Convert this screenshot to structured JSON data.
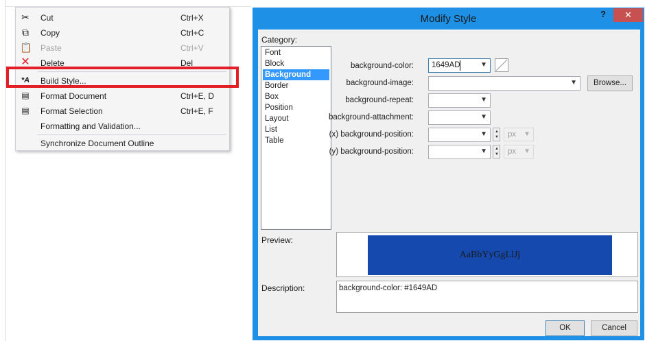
{
  "context_menu": {
    "items": [
      {
        "label": "Cut",
        "shortcut": "Ctrl+X",
        "icon": "scissors-icon",
        "disabled": false
      },
      {
        "label": "Copy",
        "shortcut": "Ctrl+C",
        "icon": "copy-icon",
        "disabled": false
      },
      {
        "label": "Paste",
        "shortcut": "Ctrl+V",
        "icon": "paste-icon",
        "disabled": true
      },
      {
        "label": "Delete",
        "shortcut": "Del",
        "icon": "delete-x-icon",
        "disabled": false
      },
      {
        "label": "Build Style...",
        "shortcut": "",
        "icon": "build-style-icon",
        "disabled": false,
        "highlighted": true
      },
      {
        "label": "Format Document",
        "shortcut": "Ctrl+E, D",
        "icon": "format-document-icon",
        "disabled": false
      },
      {
        "label": "Format Selection",
        "shortcut": "Ctrl+E, F",
        "icon": "format-selection-icon",
        "disabled": false
      },
      {
        "label": "Formatting and Validation...",
        "shortcut": "",
        "icon": "",
        "disabled": false
      },
      {
        "label": "Synchronize Document Outline",
        "shortcut": "",
        "icon": "",
        "disabled": false
      }
    ],
    "highlight_color": "#e41e26"
  },
  "dialog": {
    "title": "Modify Style",
    "help_label": "?",
    "close_label": "✕",
    "category_label": "Category:",
    "categories": [
      "Font",
      "Block",
      "Background",
      "Border",
      "Box",
      "Position",
      "Layout",
      "List",
      "Table"
    ],
    "selected_category": "Background",
    "properties": {
      "background_color": {
        "label": "background-color:",
        "value": "1649AD"
      },
      "background_image": {
        "label": "background-image:",
        "value": ""
      },
      "background_repeat": {
        "label": "background-repeat:",
        "value": ""
      },
      "background_attachment": {
        "label": "background-attachment:",
        "value": ""
      },
      "x_position": {
        "label": "(x) background-position:",
        "value": "",
        "unit": "px"
      },
      "y_position": {
        "label": "(y) background-position:",
        "value": "",
        "unit": "px"
      }
    },
    "browse_label": "Browse...",
    "preview_label": "Preview:",
    "preview_text": "AaBbYyGgLlJj",
    "preview_bg": "#1649ad",
    "description_label": "Description:",
    "description_text": "background-color: #1649AD",
    "ok_label": "OK",
    "cancel_label": "Cancel",
    "accent_color": "#1e90e6"
  }
}
